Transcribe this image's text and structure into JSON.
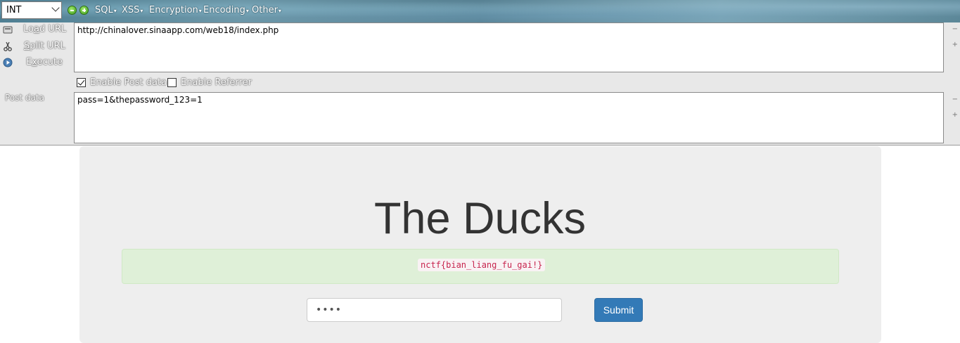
{
  "hackbar": {
    "type_select": "INT",
    "menu": [
      {
        "label": "SQL"
      },
      {
        "label": "XSS"
      },
      {
        "label": "Encryption"
      },
      {
        "label": "Encoding"
      },
      {
        "label": "Other"
      }
    ],
    "buttons": {
      "load_url": "Load URL",
      "split_url": "Split URL",
      "execute": "Execute"
    },
    "url": "http://chinalover.sinaapp.com/web18/index.php",
    "enable_post_label": "Enable Post data",
    "enable_post_checked": true,
    "enable_referrer_label": "Enable Referrer",
    "enable_referrer_checked": false,
    "post_label": "Post data",
    "post_data": "pass=1&thepassword_123=1"
  },
  "page": {
    "title": "The Ducks",
    "flag": "nctf{bian_liang_fu_gai!}",
    "password_value": "••••",
    "submit_label": "Submit"
  },
  "colors": {
    "submit_bg": "#337ab7",
    "alert_bg": "#dff0d8",
    "flag_text": "#c7254e"
  }
}
